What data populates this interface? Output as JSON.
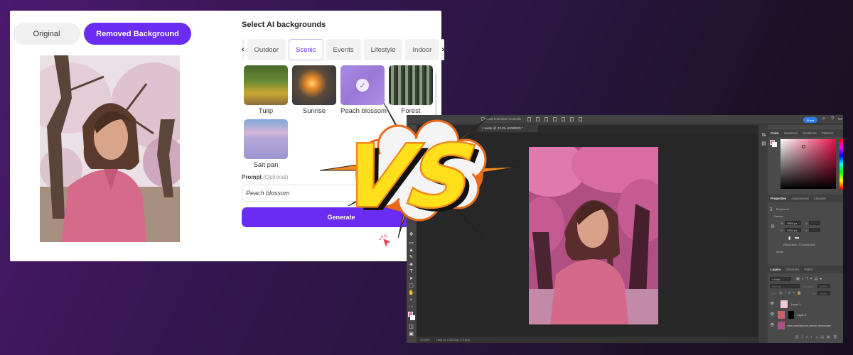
{
  "web_app": {
    "view_toggle": {
      "original_label": "Original",
      "removed_label": "Removed Background",
      "active": "Removed Background"
    },
    "panel_title": "Select AI backgrounds",
    "categories": {
      "prev_icon": "‹",
      "next_icon": "›",
      "items": [
        "Outdoor",
        "Scenic",
        "Events",
        "Lifestyle",
        "Indoor"
      ],
      "active": "Scenic"
    },
    "backgrounds": [
      {
        "label": "Tulip",
        "selected": false
      },
      {
        "label": "Sunrise",
        "selected": false
      },
      {
        "label": "Peach blossom",
        "selected": true
      },
      {
        "label": "Forest",
        "selected": false
      },
      {
        "label": "Salt pan",
        "selected": false
      }
    ],
    "check_icon": "✓",
    "prompt": {
      "label": "Prompt",
      "optional": "(Optional)",
      "value": "Peach blossom"
    },
    "generate_label": "Generate",
    "accent_color": "#6a2cf0"
  },
  "overlay": {
    "vs_text": "VS"
  },
  "photoshop": {
    "options_bar": {
      "transform_label": "Show Transform Controls",
      "share_label": "Share"
    },
    "document_tab": "1.webp @ 33.3% (RGB/8#) *",
    "color_panel_tabs": [
      "Color",
      "Swatches",
      "Gradients",
      "Patterns"
    ],
    "properties_tabs": [
      "Properties",
      "Adjustments",
      "Libraries"
    ],
    "properties": {
      "doc_label": "Document",
      "section": "Canvas",
      "width_label": "W",
      "width_value": "1664 px",
      "height_label": "H",
      "height_value": "2304 px",
      "x_label": "X",
      "y_label": "Y",
      "resolution": "Resolution: 72 pixels/inch",
      "mode_label": "Mode"
    },
    "layers_tabs": [
      "Layers",
      "Channels",
      "Paths"
    ],
    "layers_filter": "Kind",
    "blend_mode": "Normal",
    "opacity_label": "Opacity:",
    "opacity_value": "100%",
    "lock_label": "Lock:",
    "fill_label": "Fill:",
    "fill_value": "100%",
    "layers": [
      {
        "name": "Layer 1"
      },
      {
        "name": "Layer 0"
      },
      {
        "name": "view-spectacular-nature-landscape"
      }
    ],
    "status": {
      "zoom": "33.33%",
      "doc_size": "1664 px x 2304 px (72 ppi)"
    },
    "foreground_color": "#d77a9a"
  }
}
